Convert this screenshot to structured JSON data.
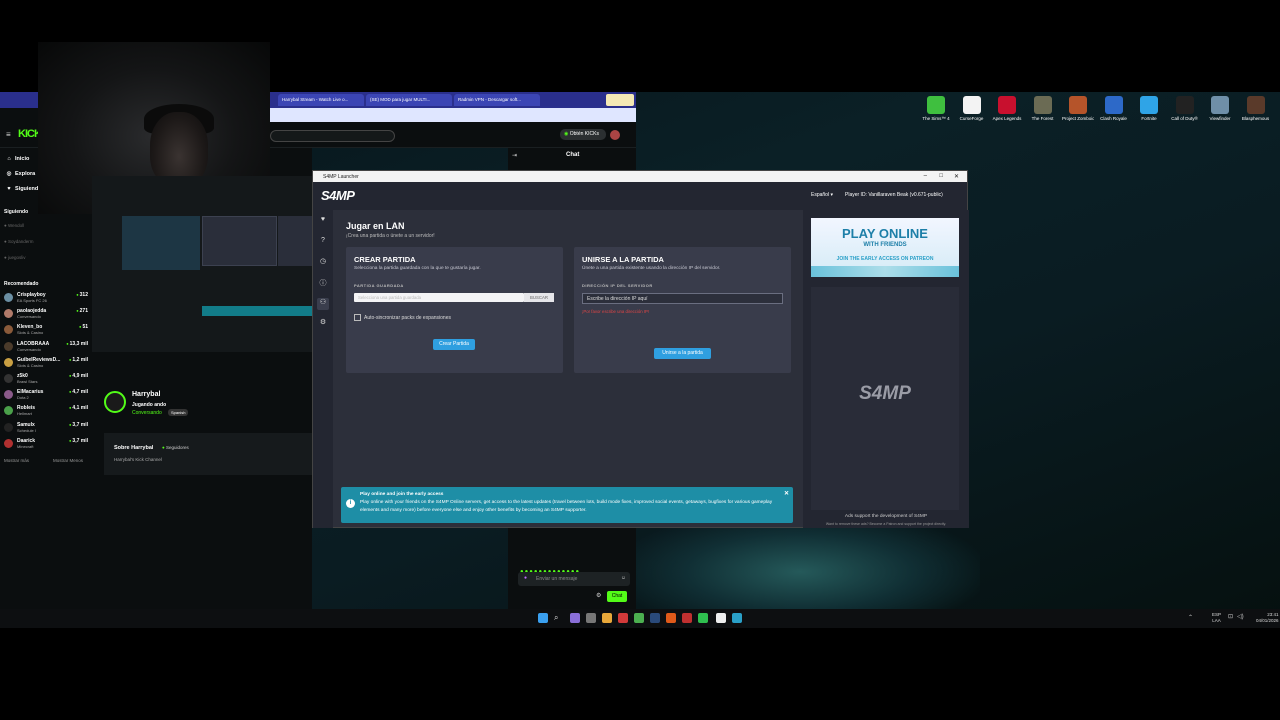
{
  "desktop_icons": [
    {
      "label": "The Sims™ 4",
      "color": "#3fbf3f"
    },
    {
      "label": "CurseForge",
      "color": "#f3f3f3"
    },
    {
      "label": "Apex Legends",
      "color": "#c8102e"
    },
    {
      "label": "The Forest",
      "color": "#6b6b54"
    },
    {
      "label": "Project Zomboid",
      "color": "#b5542a"
    },
    {
      "label": "Clash Royale",
      "color": "#2d69c8"
    },
    {
      "label": "Fortnite",
      "color": "#2fa4e7"
    },
    {
      "label": "Call of Duty®",
      "color": "#222222"
    },
    {
      "label": "Viewfinder",
      "color": "#6f8fa8"
    },
    {
      "label": "Blasphemous",
      "color": "#5a3a2a"
    }
  ],
  "browser": {
    "tabs": [
      "Harrybal Stream - Watch Live o...",
      "(SE) MOD para jugar MULTI...",
      "Radmin VPN - Descargar soft..."
    ]
  },
  "kick": {
    "logo": "KICK",
    "nav": [
      {
        "label": "Inicio",
        "icon": "home-icon",
        "glyph": "⌂"
      },
      {
        "label": "Explora",
        "icon": "compass-icon",
        "glyph": "◎"
      },
      {
        "label": "Siguiendo",
        "icon": "heart-icon",
        "glyph": "♥"
      }
    ],
    "following_title": "Siguiendo",
    "following": [
      "Wendoll",
      "Soydanderm",
      "juegosliv"
    ],
    "recommended_title": "Recomendado",
    "recommended": [
      {
        "name": "Crisplayboy",
        "game": "EA Sports FC 26",
        "count": "312",
        "color": "#6b8fa3"
      },
      {
        "name": "paolaojedda",
        "game": "Conversando",
        "count": "271",
        "color": "#b07a6a"
      },
      {
        "name": "Kleven_bo",
        "game": "Slots & Casino",
        "count": "51",
        "color": "#8a5a3a"
      },
      {
        "name": "LACOBRAAA",
        "game": "Conversando",
        "count": "13,3 mil",
        "color": "#4b3b2b"
      },
      {
        "name": "GuibelReviewsD...",
        "game": "Slots & Casino",
        "count": "1,2 mil",
        "color": "#c9a043"
      },
      {
        "name": "z5k0",
        "game": "Brawl Stars",
        "count": "4,9 mil",
        "color": "#333333"
      },
      {
        "name": "ElMacarius",
        "game": "Dota 2",
        "count": "4,7 mil",
        "color": "#8a5a8a"
      },
      {
        "name": "Robleis",
        "game": "Hellmart",
        "count": "4,1 mil",
        "color": "#4aa04a"
      },
      {
        "name": "Samulx",
        "game": "Schedule I",
        "count": "3,7 mil",
        "color": "#222222"
      },
      {
        "name": "Daarick",
        "game": "Minecraft",
        "count": "3,7 mil",
        "color": "#b03030"
      }
    ],
    "show_more": "Mostrar más",
    "show_less": "Mostrar Menos",
    "get_kicks": "Obtén KICKs",
    "chat_title": "Chat",
    "streamer": {
      "name": "Harrybal",
      "game": "Jugando ando",
      "status": "Conversando",
      "lang": "Spanish"
    },
    "about_title": "Sobre Harrybal",
    "followers_label": "Seguidores",
    "channel_desc": "Harrybal's Kick Channel",
    "chat_placeholder": "Enviar un mensaje",
    "chat_button": "Chat"
  },
  "launcher": {
    "window_title": "S4MP Launcher",
    "logo": "S4MP",
    "language": "Español",
    "player_id": "Player ID: Vanillaraven Beak (v0.671-public)",
    "section_title": "Jugar en LAN",
    "section_sub": "¡Crea una partida o únete a un servidor!",
    "create": {
      "title": "CREAR PARTIDA",
      "subtitle": "Selecciona la partida guardada con la que te gustaría jugar.",
      "field_label": "PARTIDA GUARDADA",
      "placeholder": "Selecciona una partida guardada",
      "browse": "BUSCAR",
      "checkbox_label": "Auto-sincronizar packs de expansiones",
      "button": "Crear Partida"
    },
    "join": {
      "title": "UNIRSE A LA PARTIDA",
      "subtitle": "Únete a una partida existente usando la dirección IP del servidor.",
      "field_label": "DIRECCIÓN IP DEL SERVIDOR",
      "placeholder": "Escribe la dirección IP aquí",
      "error": "¡Por favor escribe una dirección IP!",
      "button": "Unirse a la partida"
    },
    "banner": {
      "title": "Play online and join the early access",
      "body": "Play online with your friends on the S4MP Online servers, get access to the latest updates (travel between lots, build mode fixes, improved social events, getaways, bugfixes for various gameplay elements and many more) before everyone else and enjoy other benefits by becoming an S4MP supporter."
    },
    "ad": {
      "headline": "PLAY ONLINE",
      "sub": "WITH FRIENDS",
      "tag": "JOIN THE EARLY ACCESS ON PATREON",
      "placeholder_logo": "S4MP",
      "support": "Ads support the development of S4MP",
      "small": "Want to remove these ads? Become a Patron and support the project directly."
    }
  },
  "taskbar": {
    "lang": "ESP",
    "region": "LAA",
    "time": "23:41",
    "date": "04/01/2026"
  }
}
